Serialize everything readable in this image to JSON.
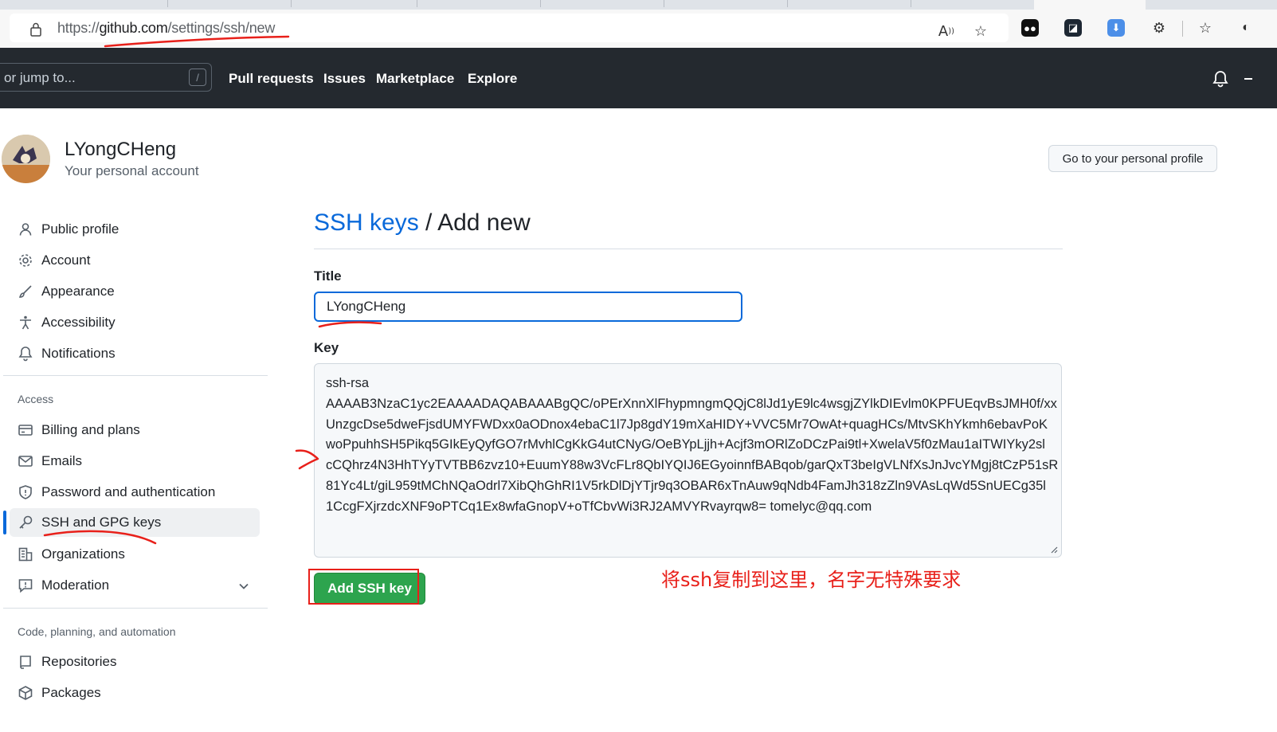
{
  "browser": {
    "url_prefix": "https://",
    "url_host": "github.com",
    "url_path": "/settings/ssh/new"
  },
  "header": {
    "search_placeholder": "or jump to...",
    "search_shortcut": "/",
    "nav": [
      "Pull requests",
      "Issues",
      "Marketplace",
      "Explore"
    ]
  },
  "profile": {
    "name": "LYongCHeng",
    "subtitle": "Your personal account",
    "profile_button": "Go to your personal profile"
  },
  "sidebar": {
    "items_top": [
      {
        "label": "Public profile",
        "icon": "person-icon"
      },
      {
        "label": "Account",
        "icon": "gear-icon"
      },
      {
        "label": "Appearance",
        "icon": "paintbrush-icon"
      },
      {
        "label": "Accessibility",
        "icon": "accessibility-icon"
      },
      {
        "label": "Notifications",
        "icon": "bell-icon"
      }
    ],
    "access_heading": "Access",
    "items_access": [
      {
        "label": "Billing and plans",
        "icon": "credit-card-icon"
      },
      {
        "label": "Emails",
        "icon": "mail-icon"
      },
      {
        "label": "Password and authentication",
        "icon": "shield-icon"
      },
      {
        "label": "SSH and GPG keys",
        "icon": "key-icon",
        "active": true
      },
      {
        "label": "Organizations",
        "icon": "organization-icon"
      },
      {
        "label": "Moderation",
        "icon": "report-icon"
      }
    ],
    "code_heading": "Code, planning, and automation",
    "items_code": [
      {
        "label": "Repositories",
        "icon": "repo-icon"
      },
      {
        "label": "Packages",
        "icon": "package-icon"
      }
    ]
  },
  "main": {
    "breadcrumb_link": "SSH keys",
    "breadcrumb_sep": " / ",
    "breadcrumb_current": "Add new",
    "title_label": "Title",
    "title_value": "LYongCHeng",
    "key_label": "Key",
    "key_lines": [
      "ssh-rsa",
      "AAAAB3NzaC1yc2EAAAADAQABAAABgQC/oPErXnnXlFhypmngmQQjC8lJd1yE9lc4wsgjZYlkDIEvlm0KPFUEqvBsJMH0f/xx",
      "UnzgcDse5dweFjsdUMYFWDxx0aODnox4ebaC1l7Jp8gdY19mXaHIDY+VVC5Mr7OwAt+quagHCs/MtvSKhYkmh6ebavPoK",
      "woPpuhhSH5Pikq5GIkEyQyfGO7rMvhlCgKkG4utCNyG/OeBYpLjjh+Acjf3mORlZoDCzPai9tl+XwelaV5f0zMau1aITWIYky2sl",
      "cCQhrz4N3HhTYyTVTBB6zvz10+EuumY88w3VcFLr8QbIYQIJ6EGyoinnfBABqob/garQxT3beIgVLNfXsJnJvcYMgj8tCzP51sR",
      "81Yc4Lt/giL959tMChNQaOdrl7XibQhGhRI1V5rkDlDjYTjr9q3OBAR6xTnAuw9qNdb4FamJh318zZln9VAsLqWd5SnUECg35l",
      "1CcgFXjrzdcXNF9oPTCq1Ex8wfaGnopV+oTfCbvWi3RJ2AMVYRvayrqw8= tomelyc@qq.com"
    ],
    "submit_label": "Add SSH key",
    "annotation_note": "将ssh复制到这里，名字无特殊要求"
  }
}
